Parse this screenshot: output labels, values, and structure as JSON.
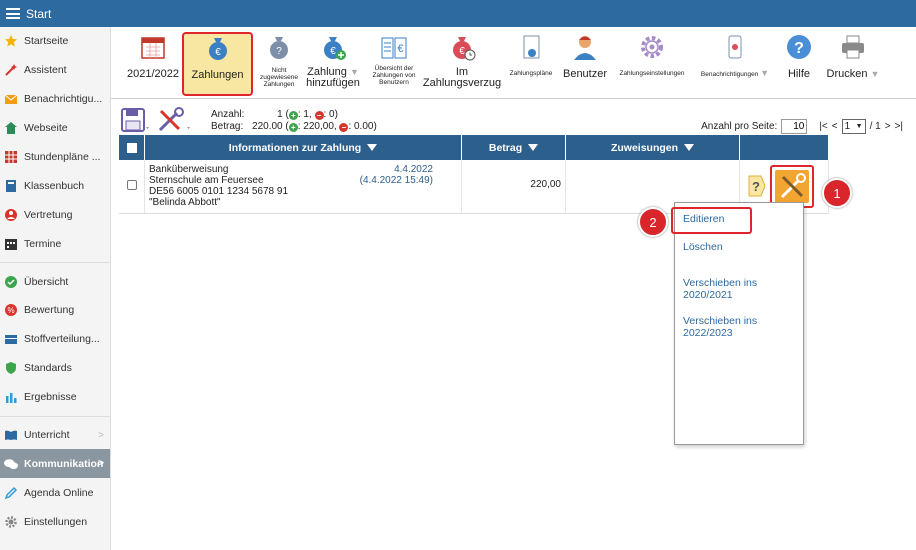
{
  "topbar": {
    "title": "Start"
  },
  "sidebar": {
    "items": [
      {
        "label": "Startseite",
        "icon": "star-icon",
        "color": "#f4b400"
      },
      {
        "label": "Assistent",
        "icon": "wand-icon",
        "color": "#d9342b"
      },
      {
        "label": "Benachrichtigu...",
        "icon": "envelope-icon",
        "color": "#f39c12"
      },
      {
        "label": "Webseite",
        "icon": "home-icon",
        "color": "#2e8b57"
      },
      {
        "label": "Stundenpläne ...",
        "icon": "timetable-icon",
        "color": "#c0392b"
      },
      {
        "label": "Klassenbuch",
        "icon": "book-icon",
        "color": "#2d6aa0"
      },
      {
        "label": "Vertretung",
        "icon": "person-icon",
        "color": "#d9342b"
      },
      {
        "label": "Termine",
        "icon": "calendar-icon",
        "color": "#333333"
      },
      {
        "label": "Übersicht",
        "icon": "check-circle-icon",
        "color": "#3aa54b"
      },
      {
        "label": "Bewertung",
        "icon": "rating-icon",
        "color": "#d9342b"
      },
      {
        "label": "Stoffverteilung...",
        "icon": "distribution-icon",
        "color": "#2d6aa0"
      },
      {
        "label": "Standards",
        "icon": "shield-icon",
        "color": "#3aa54b"
      },
      {
        "label": "Ergebnisse",
        "icon": "bar-chart-icon",
        "color": "#2d9cdb"
      },
      {
        "label": "Unterricht",
        "icon": "open-book-icon",
        "color": "#2d6aa0"
      },
      {
        "label": "Kommunikation",
        "icon": "chat-icon",
        "color": "#ffffff"
      },
      {
        "label": "Agenda Online",
        "icon": "pen-icon",
        "color": "#2d9cdb"
      },
      {
        "label": "Einstellungen",
        "icon": "gear-icon",
        "color": "#888888"
      }
    ]
  },
  "toolbar": {
    "year": "2021/2022",
    "payments": "Zahlungen",
    "unassigned_1": "Nicht",
    "unassigned_2": "zugewiesene",
    "unassigned_3": "Zahlungen",
    "add_1": "Zahlung",
    "add_2": "hinzufügen",
    "overview_1": "Übersicht der",
    "overview_2": "Zahlungen von",
    "overview_3": "Benutzern",
    "overdue_1": "Im",
    "overdue_2": "Zahlungsverzug",
    "plans": "Zahlungspläne",
    "users": "Benutzer",
    "settings": "Zahlungseinstellungen",
    "notifications": "Benachrichtigungen",
    "help": "Hilfe",
    "print": "Drucken",
    "dropdown_arrow": "▼"
  },
  "summary": {
    "count_label": "Anzahl:",
    "count_value": "1 (",
    "count_plus": "+",
    "count_pos": ": 1,",
    "count_minus": "−",
    "count_neg": ": 0)",
    "amount_label": "Betrag:",
    "amount_value": "220.00 (",
    "amount_pos": ": 220,00,",
    "amount_neg": ": 0.00)",
    "per_page_label": "Anzahl pro Seite:",
    "per_page_value": "10",
    "nav_first": "|<",
    "nav_prev": "<",
    "page_value": "1",
    "page_total": "/ 1",
    "nav_next": ">",
    "nav_last": ">|"
  },
  "grid": {
    "headers": {
      "info": "Informationen zur Zahlung",
      "amount": "Betrag",
      "assignments": "Zuweisungen"
    },
    "row": {
      "type": "Banküberweisung",
      "school": "Sternschule am Feuersee",
      "iban": "DE56 6005 0101 1234 5678 91",
      "name": "\"Belinda Abbott\"",
      "date": "4.4.2022",
      "datetime": "(4.4.2022 15:49)",
      "amount": "220,00"
    }
  },
  "menu": {
    "edit": "Editieren",
    "delete": "Löschen",
    "move1_1": "Verschieben ins",
    "move1_2": "2020/2021",
    "move2_1": "Verschieben ins",
    "move2_2": "2022/2023"
  },
  "badges": {
    "one": "1",
    "two": "2"
  }
}
